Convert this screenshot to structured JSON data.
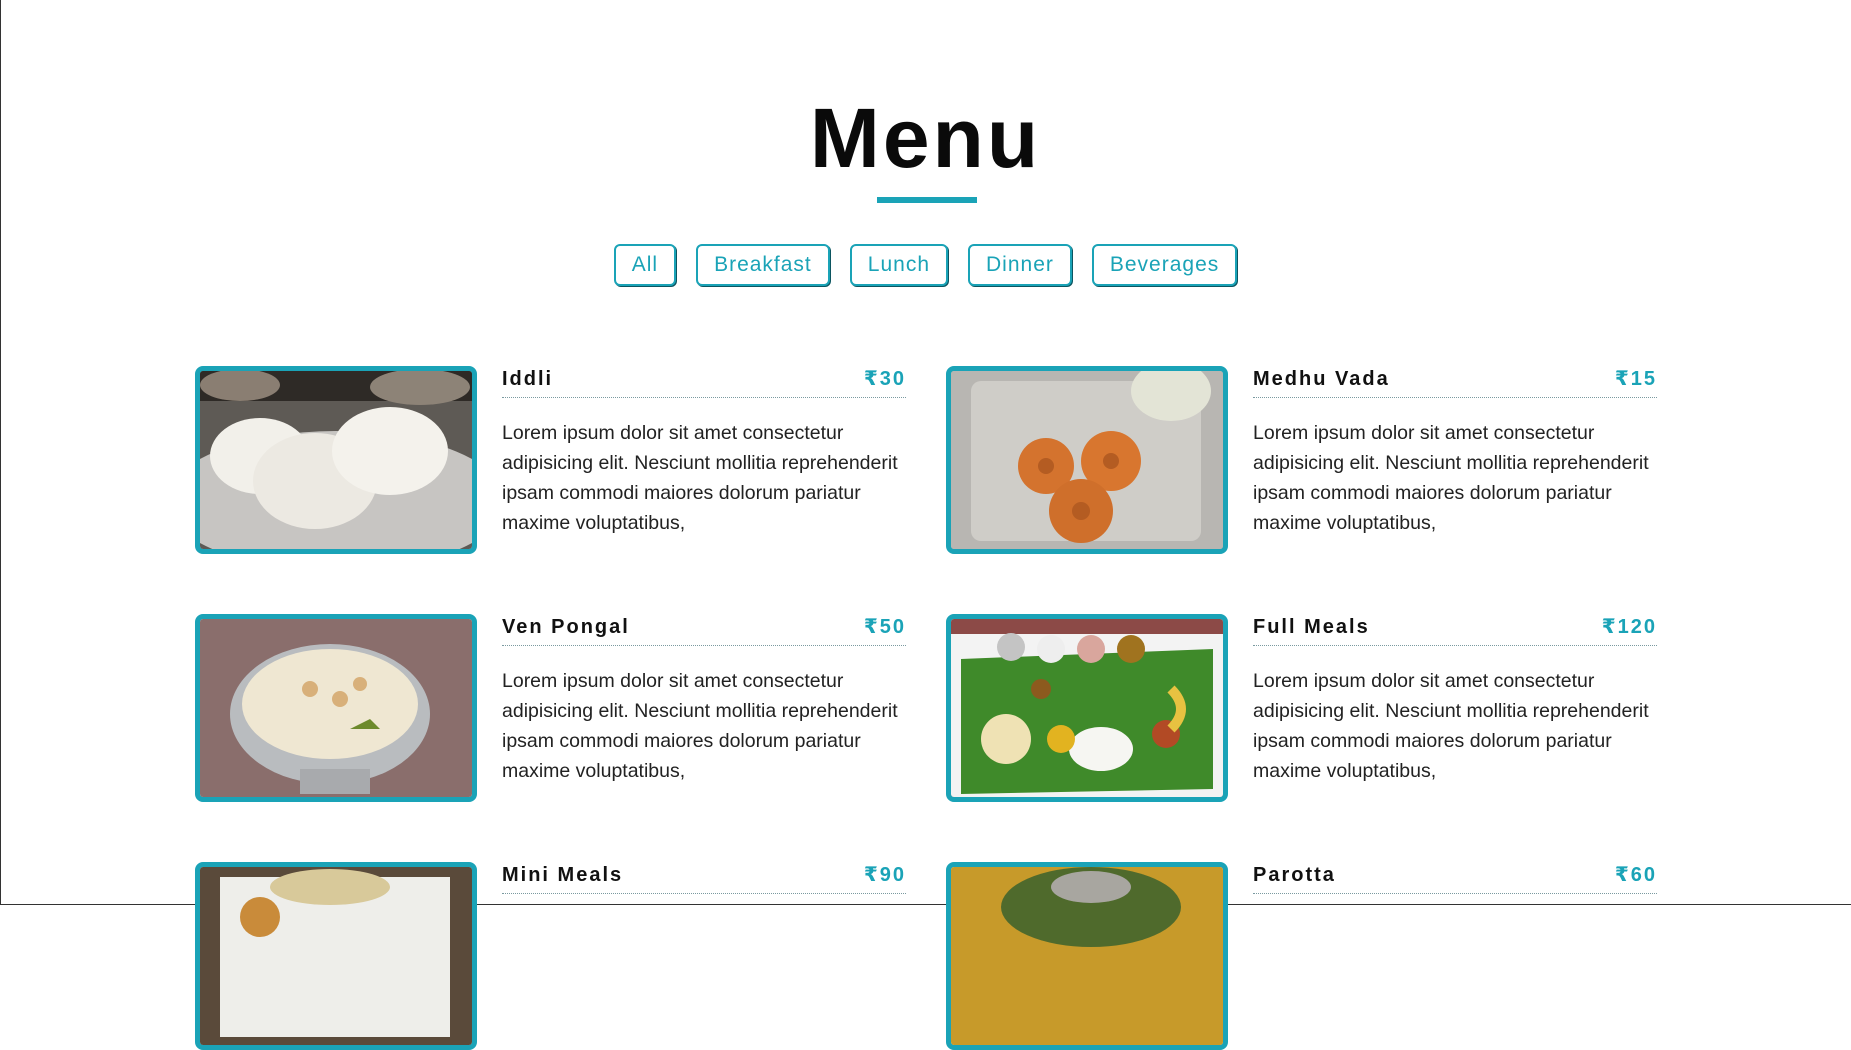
{
  "page": {
    "title": "Menu"
  },
  "filters": [
    "All",
    "Breakfast",
    "Lunch",
    "Dinner",
    "Beverages"
  ],
  "items": [
    {
      "name": "Iddli",
      "price": "₹30",
      "desc": "Lorem ipsum dolor sit amet consectetur adipisicing elit. Nesciunt mollitia reprehenderit ipsam commodi maiores dolorum pariatur maxime voluptatibus,",
      "image": "iddli-photo"
    },
    {
      "name": "Medhu Vada",
      "price": "₹15",
      "desc": "Lorem ipsum dolor sit amet consectetur adipisicing elit. Nesciunt mollitia reprehenderit ipsam commodi maiores dolorum pariatur maxime voluptatibus,",
      "image": "medhu-vada-photo"
    },
    {
      "name": "Ven Pongal",
      "price": "₹50",
      "desc": "Lorem ipsum dolor sit amet consectetur adipisicing elit. Nesciunt mollitia reprehenderit ipsam commodi maiores dolorum pariatur maxime voluptatibus,",
      "image": "ven-pongal-photo"
    },
    {
      "name": "Full Meals",
      "price": "₹120",
      "desc": "Lorem ipsum dolor sit amet consectetur adipisicing elit. Nesciunt mollitia reprehenderit ipsam commodi maiores dolorum pariatur maxime voluptatibus,",
      "image": "full-meals-photo"
    },
    {
      "name": "Mini Meals",
      "price": "₹90",
      "desc": "",
      "image": "mini-meals-photo"
    },
    {
      "name": "Parotta",
      "price": "₹60",
      "desc": "",
      "image": "parotta-photo"
    }
  ],
  "colors": {
    "accent": "#1aa3b7",
    "text": "#111111",
    "background": "#ffffff"
  }
}
